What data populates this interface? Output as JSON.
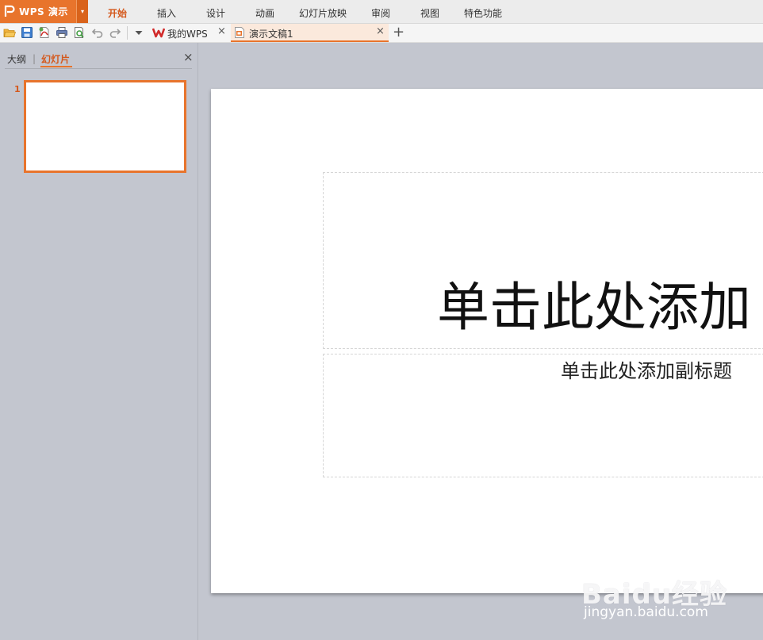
{
  "app": {
    "name": "WPS 演示",
    "dropdown_glyph": "▾"
  },
  "menu": [
    "开始",
    "插入",
    "设计",
    "动画",
    "幻灯片放映",
    "审阅",
    "视图",
    "特色功能"
  ],
  "tabs": {
    "wps_home": {
      "label": "我的WPS",
      "close": "×"
    },
    "document": {
      "label": "演示文稿1",
      "close": "×"
    },
    "new_tab": "+"
  },
  "quick_access_icons": [
    "open-folder-icon",
    "save-icon",
    "export-pdf-icon",
    "print-icon",
    "print-preview-icon",
    "undo-icon",
    "redo-icon",
    "customize-dropdown-icon"
  ],
  "panel": {
    "tab_outline": "大纲",
    "divider": "|",
    "tab_slides": "幻灯片",
    "close": "×",
    "slides": [
      {
        "number": "1"
      }
    ]
  },
  "slide": {
    "title_placeholder": "单击此处添加",
    "subtitle_placeholder": "单击此处添加副标题"
  },
  "watermark": {
    "brand": "Baidu经验",
    "url": "jingyan.baidu.com"
  },
  "colors": {
    "accent": "#e8742c",
    "accent_text": "#d4581c",
    "workspace": "#c3c6cf"
  }
}
